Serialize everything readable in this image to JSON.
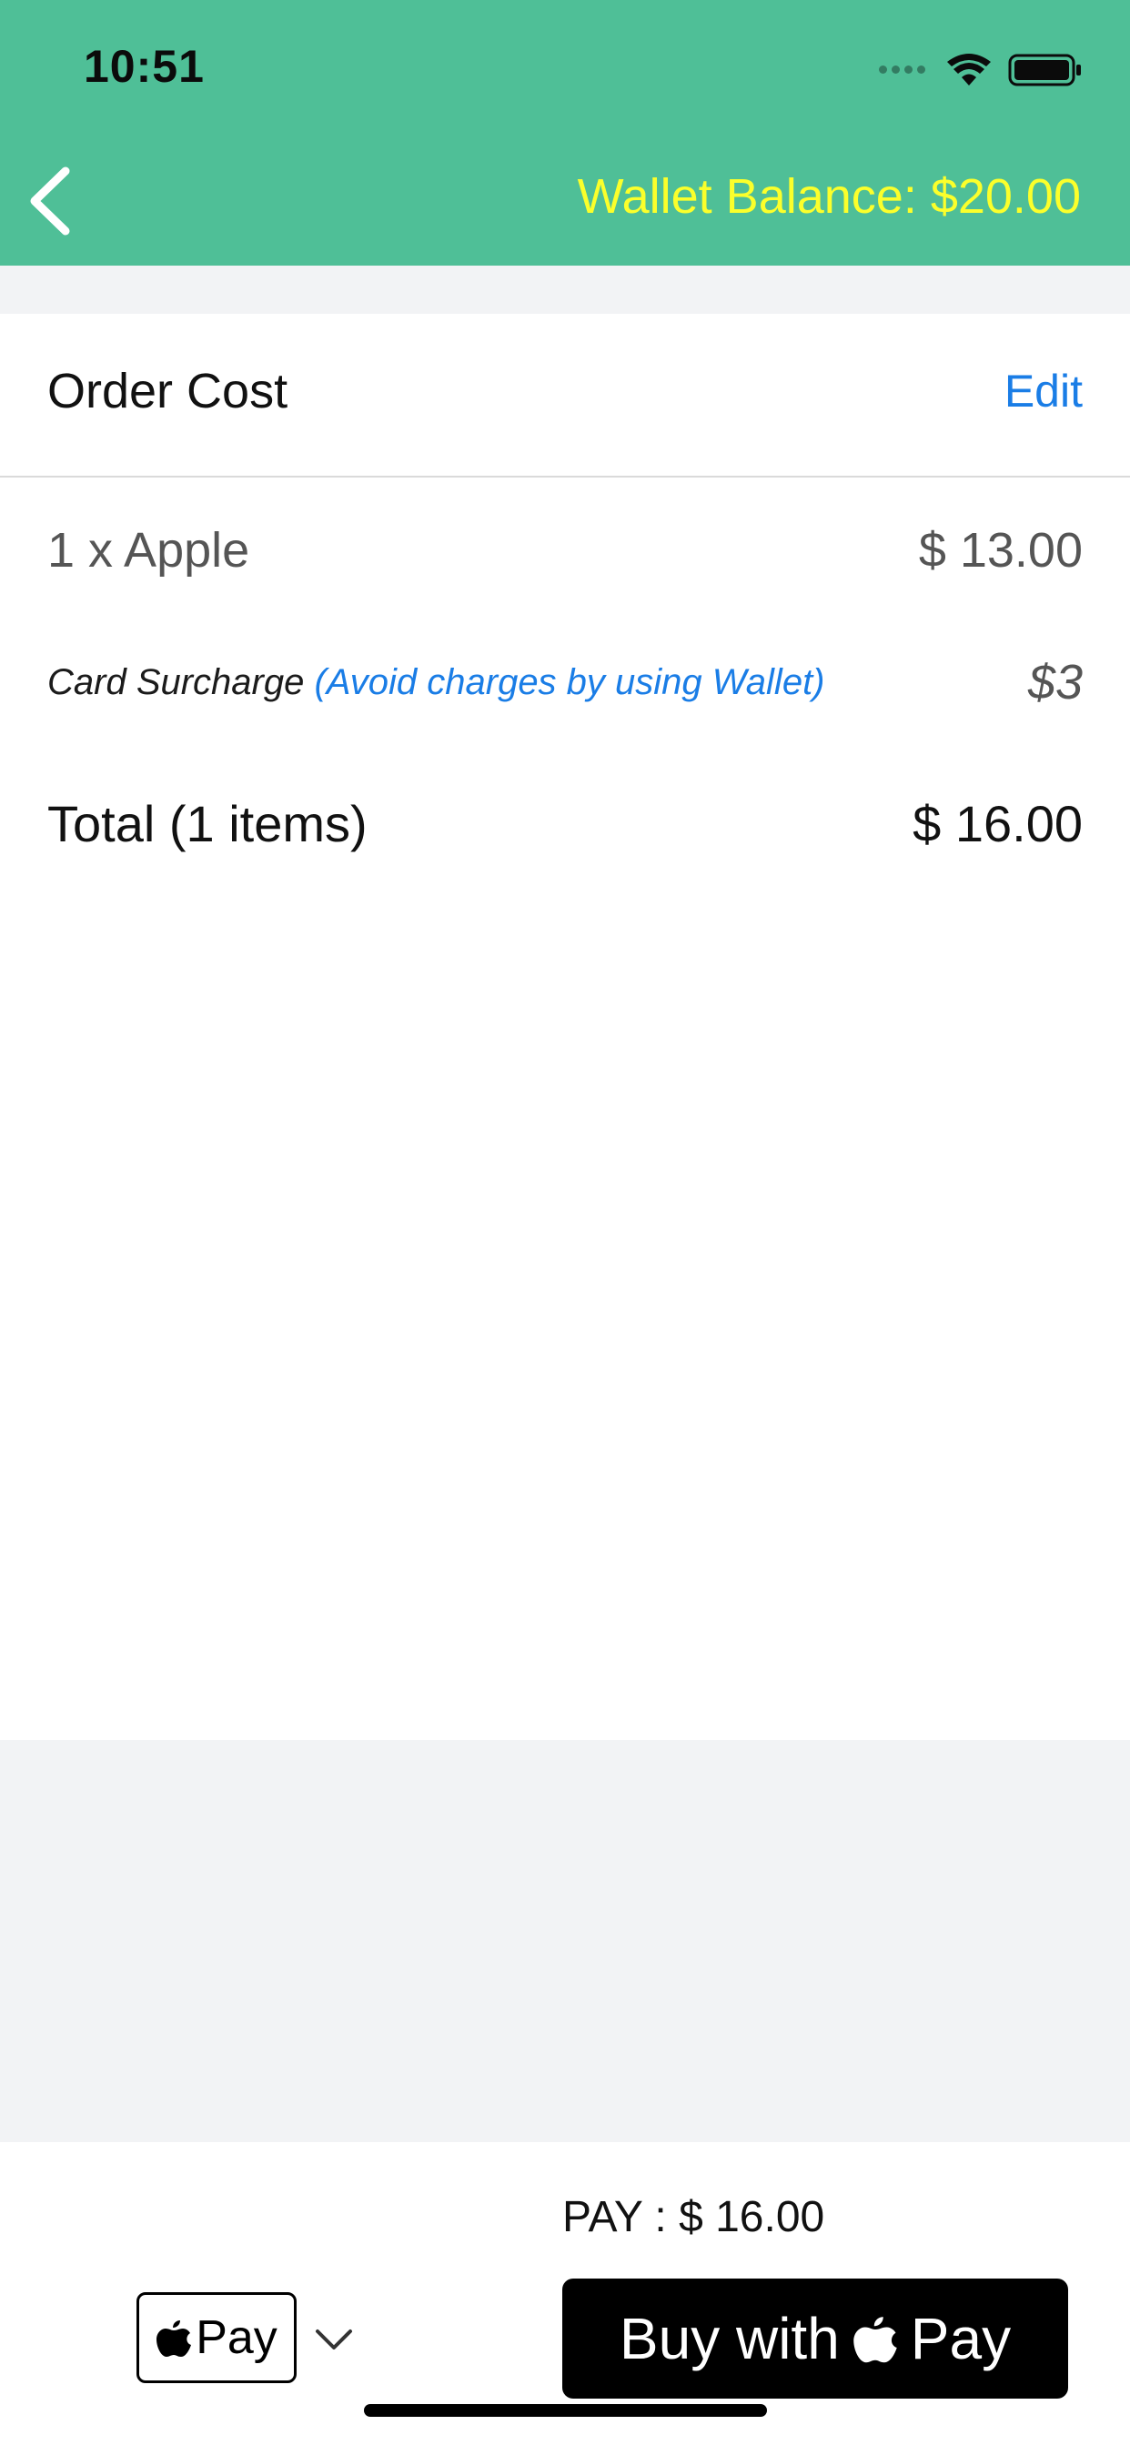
{
  "status_bar": {
    "time": "10:51"
  },
  "header": {
    "wallet_balance": "Wallet Balance: $20.00"
  },
  "order": {
    "title": "Order Cost",
    "edit_label": "Edit",
    "items": [
      {
        "label": "1 x Apple",
        "price": "$ 13.00"
      }
    ],
    "surcharge": {
      "label": "Card Surcharge ",
      "note": "(Avoid charges by using Wallet)",
      "value": "$3"
    },
    "total": {
      "label": "Total (1 items)",
      "value": "$ 16.00"
    }
  },
  "payment": {
    "pay_total": "PAY : $ 16.00",
    "apple_pay_mark_text": "Pay",
    "buy_button_text": "Buy with",
    "buy_button_pay_text": "Pay"
  },
  "colors": {
    "header_bg": "#4fbf97",
    "wallet_text": "#fbff2b",
    "link_blue": "#1a7de6",
    "page_bg": "#f2f3f5"
  },
  "icons": {
    "back": "chevron-left-icon",
    "signal": "signal-dots-icon",
    "wifi": "wifi-icon",
    "battery": "battery-icon",
    "apple": "apple-logo-icon",
    "dropdown": "chevron-down-icon"
  }
}
